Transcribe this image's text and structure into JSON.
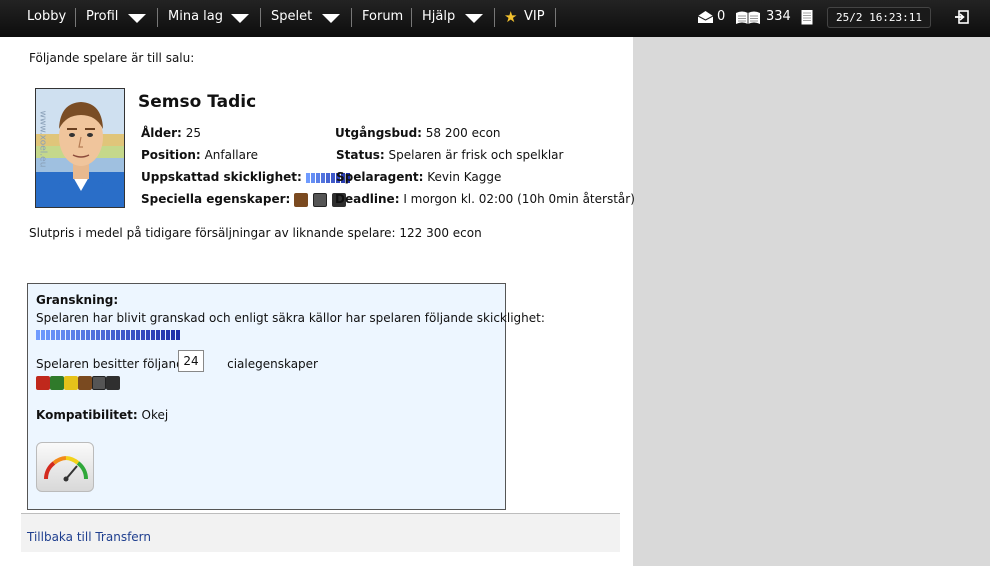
{
  "nav": {
    "lobby": "Lobby",
    "profil": "Profil",
    "mina_lag": "Mina lag",
    "spelet": "Spelet",
    "forum": "Forum",
    "hjalp": "Hjälp",
    "vip": "VIP",
    "messages_count": "0",
    "news_count": "334",
    "datetime": "25/2 16:23:11"
  },
  "page": {
    "intro": "Följande spelare är till salu:",
    "player_name": "Semso Tadic",
    "photo_watermark": "www.xoel.eu",
    "labels": {
      "age": "Ålder:",
      "position": "Position:",
      "estimated_skill": "Uppskattad skicklighet:",
      "special": "Speciella egenskaper:",
      "start_bid": "Utgångsbud:",
      "status": "Status:",
      "agent": "Spelaragent:",
      "deadline": "Deadline:"
    },
    "values": {
      "age": "25",
      "position": "Anfallare",
      "start_bid": "58 200 econ",
      "status": "Spelaren är frisk och spelklar",
      "agent": "Kevin Kagge",
      "deadline": "I morgon kl. 02:00 (10h 0min återstår)"
    },
    "estimated_skill_segments": 9,
    "avg_price": "Slutpris i medel på tidigare försäljningar av liknande spelare: 122 300 econ",
    "granskning": {
      "title": "Granskning:",
      "skill_text": "Spelaren har blivit granskad och enligt säkra källor har spelaren följande skicklighet:",
      "skill_segments": 29,
      "special_text_a": "Spelaren besitter följande",
      "special_text_b": "cialegenskaper",
      "compat_label": "Kompatibilitet:",
      "compat_value": "Okej"
    },
    "tooltip": "24",
    "back_link": "Tillbaka till Transfern"
  },
  "colors": {
    "nav_bg": "#111111",
    "skill_light": "#6f9bff",
    "skill_dark": "#1f2fa8",
    "link": "#1f3f8f",
    "panel_bg": "#edf6ff"
  }
}
